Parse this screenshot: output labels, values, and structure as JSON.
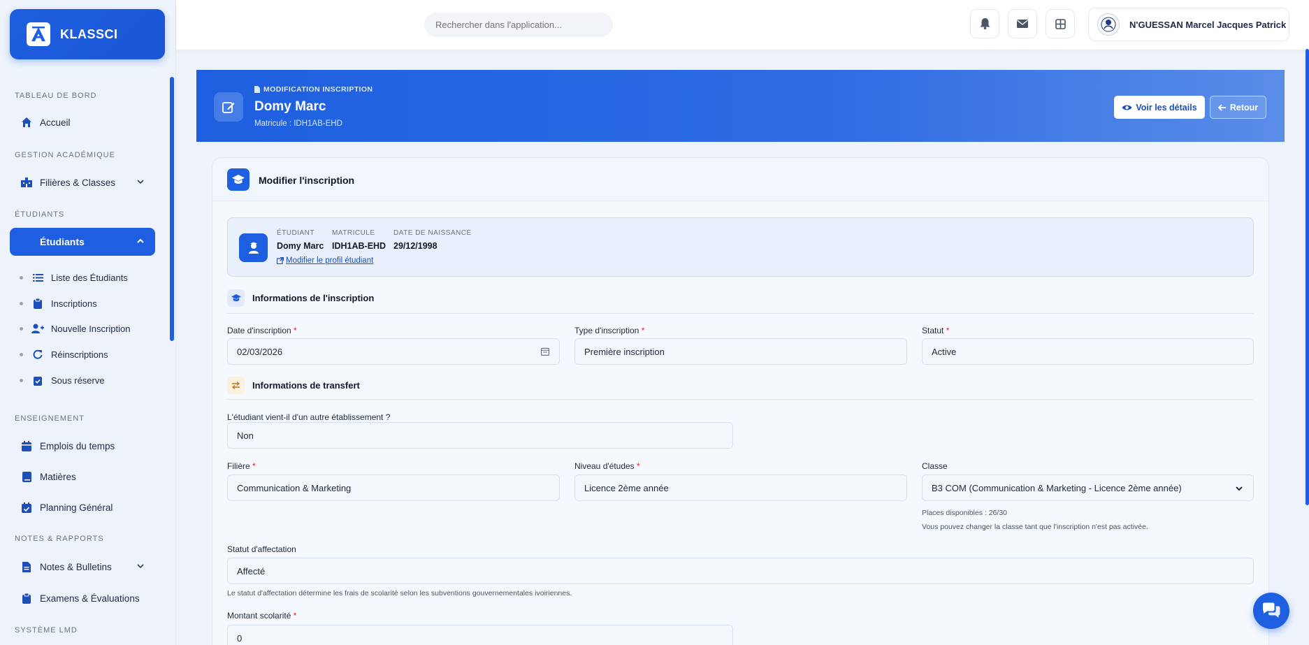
{
  "brand": {
    "name": "KLASSCI"
  },
  "sidebar": {
    "sections": {
      "dashboard": "TABLEAU DE BORD",
      "academic": "GESTION ACADÉMIQUE",
      "students": "ÉTUDIANTS",
      "teaching": "ENSEIGNEMENT",
      "notes": "NOTES & RAPPORTS",
      "lmd": "SYSTÈME LMD"
    },
    "items": {
      "home": "Accueil",
      "filieres": "Filières & Classes",
      "students": "Étudiants",
      "schedule": "Emplois du temps",
      "subjects": "Matières",
      "planning": "Planning Général",
      "notes": "Notes & Bulletins",
      "exams": "Examens & Évaluations"
    },
    "sub_items": {
      "list": "Liste des Étudiants",
      "inscriptions": "Inscriptions",
      "new": "Nouvelle Inscription",
      "reinscriptions": "Réinscriptions",
      "reserve": "Sous réserve"
    }
  },
  "header": {
    "search_placeholder": "Rechercher dans l'application...",
    "user_name": "N'GUESSAN Marcel Jacques Patrick"
  },
  "banner": {
    "kicker": "MODIFICATION INSCRIPTION",
    "title": "Domy Marc",
    "subtitle": "Matricule : IDH1AB-EHD",
    "details_label": "Voir les détails",
    "back_label": "Retour"
  },
  "card": {
    "title": "Modifier l'inscription",
    "student": {
      "labels": {
        "student": "ÉTUDIANT",
        "matricule": "MATRICULE",
        "birth": "DATE DE NAISSANCE"
      },
      "values": {
        "student": "Domy Marc",
        "matricule": "IDH1AB-EHD",
        "birth": "29/12/1998"
      },
      "edit_link": "Modifier le profil étudiant"
    },
    "section_inscription": "Informations de l'inscription",
    "section_transfer": "Informations de transfert",
    "fields": {
      "date_label": "Date d'inscription",
      "date_value": "02/03/2026",
      "type_label": "Type d'inscription",
      "type_value": "Première inscription",
      "status_label": "Statut",
      "status_value": "Active",
      "transfer_label": "L'étudiant vient-il d'un autre établissement ?",
      "transfer_value": "Non",
      "filiere_label": "Filière",
      "filiere_value": "Communication & Marketing",
      "niveau_label": "Niveau d'études",
      "niveau_value": "Licence 2ème année",
      "classe_label": "Classe",
      "classe_value": "B3 COM (Communication & Marketing - Licence 2ème année)",
      "places_hint": "Places disponibles : 26/30",
      "change_hint": "Vous pouvez changer la classe tant que l'inscription n'est pas activée.",
      "affect_label": "Statut d'affectation",
      "affect_value": "Affecté",
      "affect_hint": "Le statut d'affectation détermine les frais de scolarité selon les subventions gouvernementales ivoiriennes.",
      "montant_label": "Montant scolarité",
      "montant_value": "0",
      "required_mark": "*"
    }
  },
  "colors": {
    "primary": "#1d5fe0",
    "background": "#eef3fb"
  }
}
